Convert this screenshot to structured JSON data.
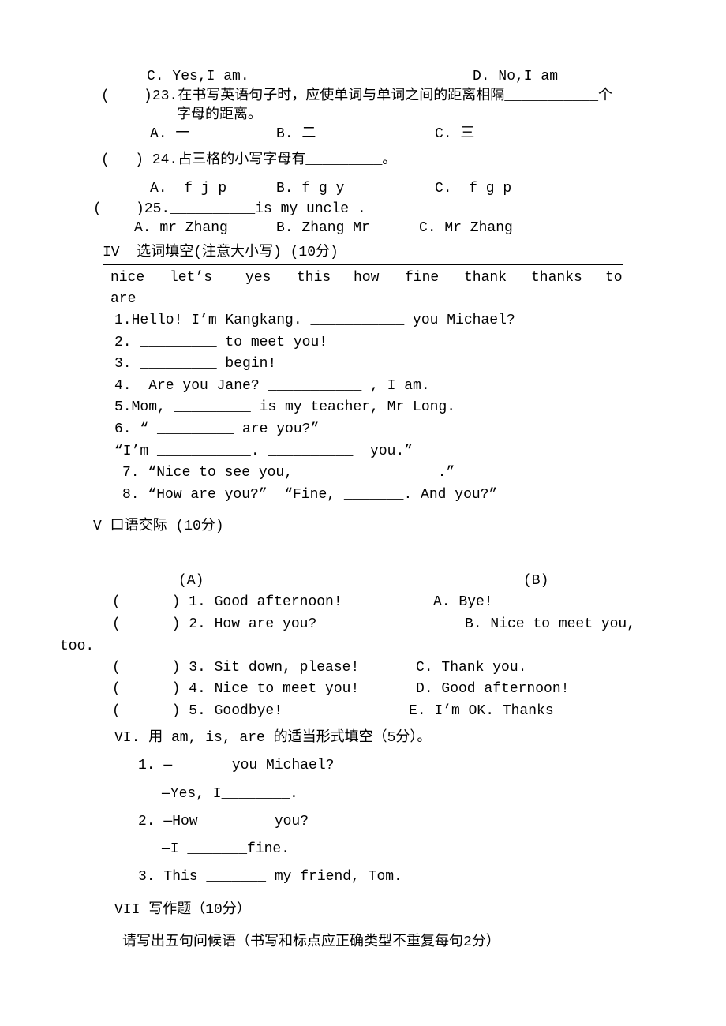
{
  "q22": {
    "c": "C. Yes,I am.",
    "d": "D. No,I am"
  },
  "q23": {
    "stem": "(    )23.在书写英语句子时，应使单词与单词之间的距离相隔___________个",
    "stem2": "字母的距离。",
    "a": "A. 一",
    "b": "B. 二",
    "c": "C. 三"
  },
  "q24": {
    "stem": "(   ) 24.占三格的小写字母有_________。",
    "a": "A.  f j p",
    "b": "B. f g y",
    "c": "C.  f g p"
  },
  "q25": {
    "stem": "(    )25.__________is my uncle .",
    "a": "A. mr Zhang",
    "b": "B. Zhang Mr",
    "c": "C. Mr Zhang"
  },
  "section4": {
    "title": "IV  选词填空(注意大小写) (10分)",
    "words": [
      "nice",
      "let’s",
      "yes",
      "this",
      "how",
      "fine",
      "thank",
      "thanks",
      "to",
      "are"
    ],
    "items": [
      "1.Hello! I’m Kangkang. ___________ you Michael?",
      "2. _________ to meet you!",
      "3. _________ begin!",
      "4.  Are you Jane? ___________ , I am.",
      "5.Mom, _________ is my teacher, Mr Long.",
      "6. “ _________ are you?”",
      "“I’m ___________. __________  you.”",
      "7. “Nice to see you, ________________.”",
      "8. “How are you?”  “Fine, _______. And you?”"
    ]
  },
  "section5": {
    "title": "V 口语交际 (10分)",
    "col_a": "(A)",
    "col_b": "(B)",
    "left": [
      "(      ) 1. Good afternoon!",
      "(      ) 2. How are you?",
      "(      ) 3. Sit down, please!",
      "(      ) 4. Nice to meet you!",
      "(      ) 5. Goodbye!"
    ],
    "right": [
      "A. Bye!",
      "B. Nice to meet you,",
      "C. Thank you.",
      "D. Good afternoon!",
      "E. I’m OK. Thanks"
    ],
    "wrap": "too."
  },
  "section6": {
    "title": "VI. 用 am, is, are 的适当形式填空（5分）。",
    "items": [
      "1. —_______you Michael?",
      "—Yes, I________.",
      "2. —How _______ you?",
      "—I _______fine.",
      "3. This _______ my friend, Tom."
    ]
  },
  "section7": {
    "title": "VII 写作题（10分）",
    "prompt": "请写出五句问候语（书写和标点应正确类型不重复每句2分）"
  }
}
